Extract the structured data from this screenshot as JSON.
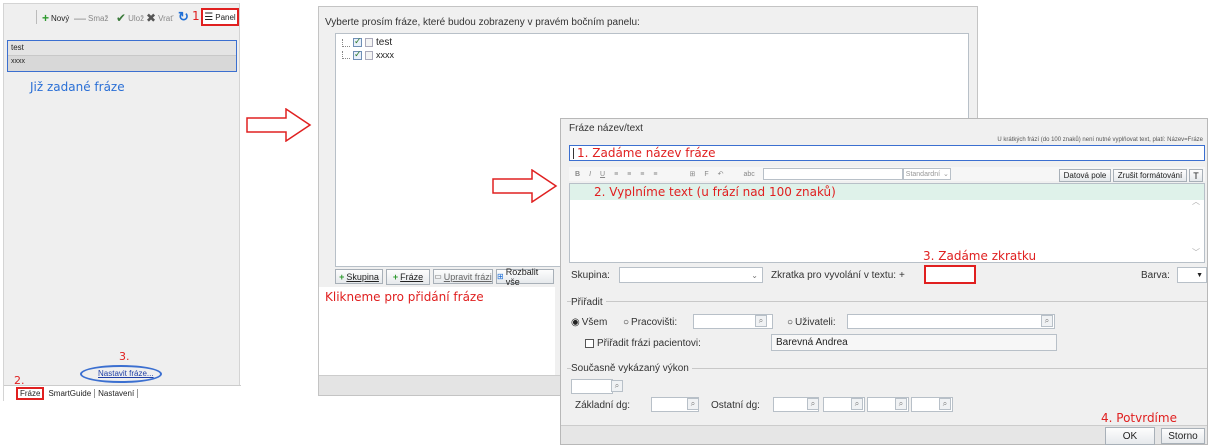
{
  "left_panel": {
    "toolbar": {
      "new_label": "Nový",
      "delete_label": "Smaž",
      "save_label": "Ulož",
      "revert_label": "Vrať",
      "step1": "1",
      "panel_label": "Panel"
    },
    "phrases": [
      "test",
      "xxxx"
    ],
    "annotation_existing": "Již zadané fráze",
    "step2": "2.",
    "step3": "3.",
    "settings_link": "Nastavit fráze...",
    "tabs": [
      "Fráze",
      "SmartGuide",
      "Nastavení"
    ]
  },
  "select_dialog": {
    "prompt": "Vyberte prosím fráze, které budou zobrazeny v pravém bočním panelu:",
    "tree": [
      "test",
      "xxxx"
    ],
    "buttons": {
      "group": "Skupina",
      "phrase": "Fráze",
      "edit": "Upravit frázi",
      "expand": "Rozbalit vše"
    },
    "annotation_click": "Klikneme pro přidání fráze"
  },
  "edit_dialog": {
    "title_label": "Fráze název/text",
    "hint": "U krátkých frází (do 100 znaků) není nutné vyplňovat text, platí: Název=Fráze",
    "name_value": "1. Zadáme název fráze",
    "font_select": "Standardní",
    "data_field_button": "Datová pole",
    "clear_format_button": "Zrušit formátování",
    "t_button": "T",
    "text_value": "2. Vyplníme text (u frází nad 100 znaků)",
    "step3_note": "3. Zadáme zkratku",
    "group_label": "Skupina:",
    "shortcut_label": "Zkratka pro vyvolání v textu:",
    "shortcut_prefix": "+",
    "color_label": "Barva:",
    "assign_title": "Přiřadit",
    "radio_all": "Všem",
    "radio_workplace": "Pracovišti:",
    "radio_users": "Uživateli:",
    "assign_patient": "Přiřadit frázi pacientovi:",
    "patient_value": "Barevná Andrea",
    "performance_title": "Současně vykázaný výkon",
    "basic_dg": "Základní dg:",
    "other_dg": "Ostatní dg:",
    "step4": "4. Potvrdíme",
    "ok_button": "OK",
    "cancel_button": "Storno"
  }
}
